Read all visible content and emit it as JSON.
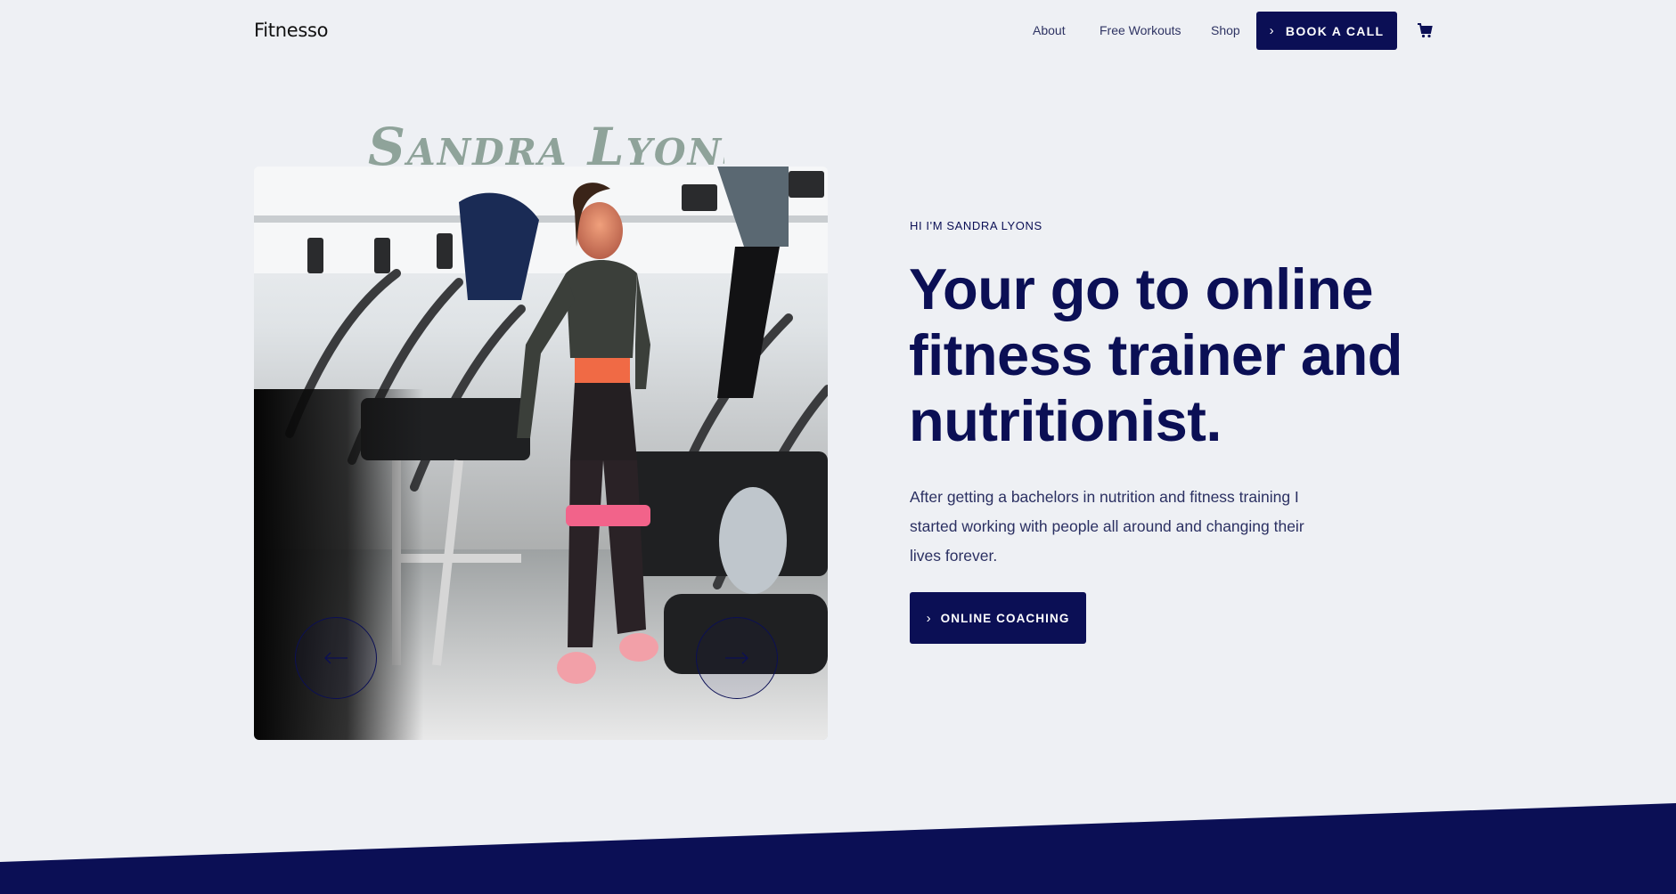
{
  "header": {
    "logo": "Fitnesso",
    "nav": [
      "About",
      "Free Workouts",
      "Shop"
    ],
    "book_call_label": "BOOK A CALL",
    "cart_icon": "cart-icon"
  },
  "hero": {
    "signature": "Sandra Lyons",
    "eyebrow": "HI I'M SANDRA LYONS",
    "headline": "Your go to online fitness trainer and nutritionist.",
    "description": "After getting a bachelors in nutrition and fitness training I started working with people all around and changing their lives forever.",
    "cta_label": "ONLINE COACHING",
    "prev_icon": "arrow-left-icon",
    "next_icon": "arrow-right-icon"
  },
  "colors": {
    "navy": "#0b0f55",
    "background": "#eef0f4",
    "signature": "#8fa39a",
    "band_pink": "#ff6f8f"
  }
}
